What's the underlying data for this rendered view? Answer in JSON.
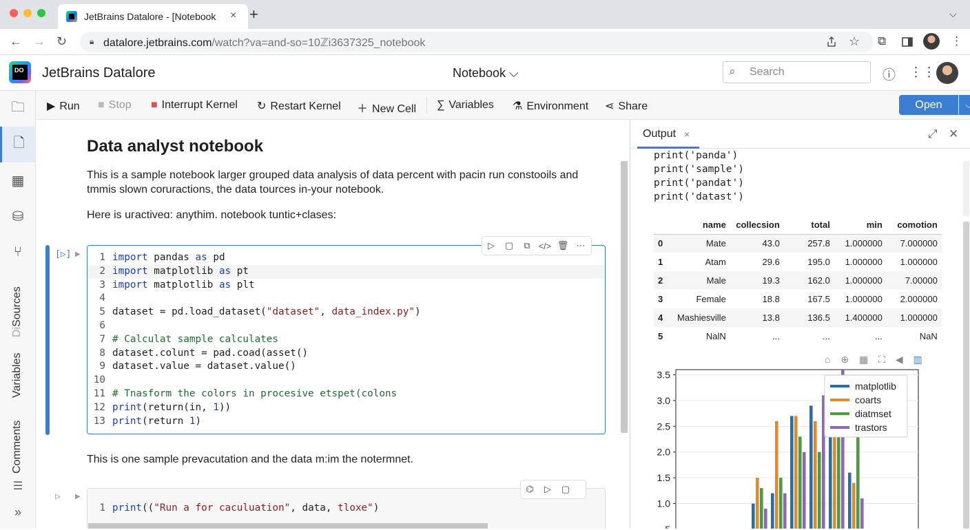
{
  "browser": {
    "tab_title": "JetBrains Datalore - [Notebook",
    "tab_close": "×",
    "new_tab": "+",
    "url_host": "datalore.jetbrains.com",
    "url_path": "/watch?va=and-so=10ℤi3637325_notebook"
  },
  "app": {
    "name": "JetBrains Datalore",
    "logo_text": "DO",
    "notebook_menu": "Notebook ⌵",
    "search_placeholder": "Search"
  },
  "sidebar": {
    "labels": [
      "Sources",
      "Variables",
      "Comments"
    ],
    "sources_prefix": "Di"
  },
  "toolbar": {
    "run": "Run",
    "stop": "Stop",
    "interrupt": "Interrupt Kernel",
    "restart": "Restart Kernel",
    "new_cell": "New Cell",
    "variables": "Variables",
    "environment": "Environment",
    "share": "Share",
    "open": "Open"
  },
  "notebook": {
    "title": "Data analyst notebook",
    "intro": "This is a sample notebook larger grouped data analysis of data percent with pacin run constooils and tmmis slown coruractions, the data tources in-your notebook.",
    "subtitle": "Here is uгactiveɑ: anythim. notebook tuntic+clases:",
    "cell1_prompt": "[▷]",
    "between_text": "This is one sample prevacutation and the data m:im the notermnet.",
    "cell2_prompt": "▷",
    "cell2_line": "1"
  },
  "output": {
    "tab": "Output",
    "prints": [
      "print('panda')",
      "print('sample')",
      "print('pandat')",
      "print('datast')"
    ],
    "table": {
      "columns": [
        "",
        "name",
        "collecsion",
        "total",
        "min",
        "comotion"
      ],
      "rows": [
        [
          "0",
          "Mate",
          "43.0",
          "257.8",
          "1.000000",
          "7.000000"
        ],
        [
          "1",
          "Atam",
          "29.6",
          "195.0",
          "1.000000",
          "1.000000"
        ],
        [
          "2",
          "Male",
          "19.3",
          "162.0",
          "1.000000",
          "7.00000"
        ],
        [
          "3",
          "Female",
          "18.8",
          "167.5",
          "1.000000",
          "2.000000"
        ],
        [
          "4",
          "Mashiesville",
          "13.8",
          "136.5",
          "1.400000",
          "1.000000"
        ],
        [
          "5",
          "NalN",
          "...",
          "...",
          "...",
          "NaN"
        ]
      ]
    }
  },
  "chart_data": {
    "type": "bar",
    "title": "",
    "xlabel": "",
    "ylabel": "",
    "ylim": [
      0.5,
      3.6
    ],
    "yticks": [
      "3.5",
      "3.0",
      "2.5",
      "2.0",
      "1.5",
      "1.0",
      "5"
    ],
    "legend_position": "top-right",
    "grid": true,
    "series": [
      {
        "name": "matplotlib",
        "color": "#2b6ea6",
        "values": [
          0.05,
          0.1,
          0.4,
          1.0,
          1.2,
          2.7,
          2.9,
          3.5,
          1.6,
          0.4,
          0.1
        ]
      },
      {
        "name": "coarts",
        "color": "#e08a2c",
        "values": [
          0.0,
          0.05,
          0.2,
          1.5,
          2.6,
          2.7,
          2.6,
          2.7,
          1.4,
          0.2,
          0.05
        ]
      },
      {
        "name": "diatmset",
        "color": "#4c9b3f",
        "values": [
          0.05,
          0.1,
          0.3,
          1.3,
          1.5,
          2.3,
          2.0,
          2.4,
          2.6,
          0.3,
          0.05
        ]
      },
      {
        "name": "trastors",
        "color": "#8f67b8",
        "values": [
          0.0,
          0.0,
          0.5,
          0.9,
          1.2,
          2.0,
          3.1,
          4.5,
          1.1,
          0.2,
          0.0
        ]
      }
    ]
  }
}
